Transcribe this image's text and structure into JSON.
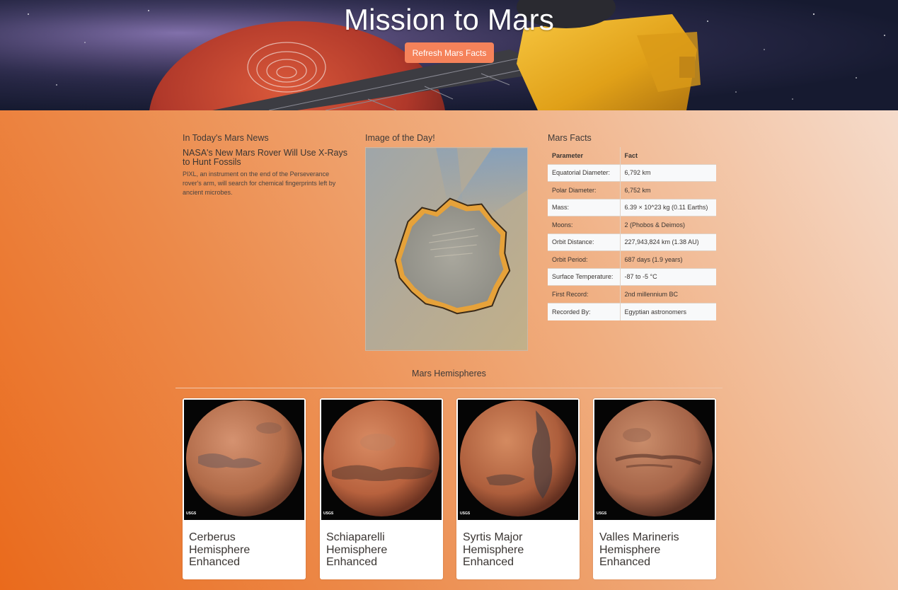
{
  "hero": {
    "title": "Mission to Mars",
    "refresh_label": "Refresh Mars Facts"
  },
  "news": {
    "heading": "In Today's Mars News",
    "title": "NASA's New Mars Rover Will Use X-Rays to Hunt Fossils",
    "teaser": "PIXL, an instrument on the end of the Perseverance rover's arm, will search for chemical fingerprints left by ancient microbes."
  },
  "featured": {
    "heading": "Image of the Day!"
  },
  "facts": {
    "heading": "Mars Facts",
    "columns": [
      "Parameter",
      "Fact"
    ],
    "rows": [
      [
        "Equatorial Diameter:",
        "6,792 km"
      ],
      [
        "Polar Diameter:",
        "6,752 km"
      ],
      [
        "Mass:",
        "6.39 × 10^23 kg (0.11 Earths)"
      ],
      [
        "Moons:",
        "2 (Phobos & Deimos)"
      ],
      [
        "Orbit Distance:",
        "227,943,824 km (1.38 AU)"
      ],
      [
        "Orbit Period:",
        "687 days (1.9 years)"
      ],
      [
        "Surface Temperature:",
        "-87 to -5 °C"
      ],
      [
        "First Record:",
        "2nd millennium BC"
      ],
      [
        "Recorded By:",
        "Egyptian astronomers"
      ]
    ]
  },
  "hemispheres": {
    "heading": "Mars Hemispheres",
    "items": [
      {
        "title": "Cerberus Hemisphere Enhanced"
      },
      {
        "title": "Schiaparelli Hemisphere Enhanced"
      },
      {
        "title": "Syrtis Major Hemisphere Enhanced"
      },
      {
        "title": "Valles Marineris Hemisphere Enhanced"
      }
    ],
    "logo_text": "USGS"
  },
  "colors": {
    "accent_button": "#f5825a",
    "background_start": "#ea6a1c",
    "background_end": "#f6e2d6"
  }
}
